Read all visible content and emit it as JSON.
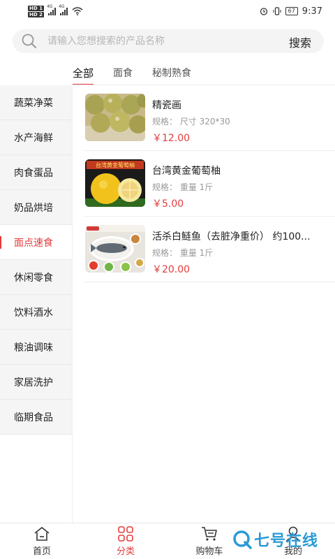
{
  "status_bar": {
    "network_1": "4G",
    "network_2": "4G",
    "hd_1": "HD 1",
    "hd_2": "HD 2",
    "battery": "67",
    "time": "9:37"
  },
  "search": {
    "placeholder": "请输入您想搜索的产品名称",
    "button_label": "搜索"
  },
  "tabs": [
    {
      "label": "全部",
      "active": true
    },
    {
      "label": "面食",
      "active": false
    },
    {
      "label": "秘制熟食",
      "active": false
    }
  ],
  "sidebar": {
    "items": [
      {
        "label": "蔬菜净菜"
      },
      {
        "label": "水产海鲜"
      },
      {
        "label": "肉食蛋品"
      },
      {
        "label": "奶品烘培"
      },
      {
        "label": "面点速食",
        "active": true
      },
      {
        "label": "休闲零食"
      },
      {
        "label": "饮料酒水"
      },
      {
        "label": "粮油调味"
      },
      {
        "label": "家居洗护"
      },
      {
        "label": "临期食品"
      }
    ]
  },
  "products": [
    {
      "name": "精瓷画",
      "spec": "规格：  尺寸 320*30",
      "price": "￥12.00",
      "image_icon": "fruit-photo"
    },
    {
      "name": "台湾黄金葡萄柚",
      "spec": "规格：  重量 1斤",
      "price": "￥5.00",
      "image_icon": "grapefruit-photo",
      "image_banner": "台湾黄金葡萄柚"
    },
    {
      "name": "活杀白鲢鱼（去脏净重价） 约100...",
      "spec": "规格：  重量 1斤",
      "price": "￥20.00",
      "image_icon": "fish-dish-photo"
    }
  ],
  "bottom_nav": [
    {
      "label": "首页",
      "icon": "home-icon",
      "active": false
    },
    {
      "label": "分类",
      "icon": "category-icon",
      "active": true
    },
    {
      "label": "购物车",
      "icon": "cart-icon",
      "active": false
    },
    {
      "label": "我的",
      "icon": "profile-icon",
      "active": false
    }
  ],
  "watermark": {
    "text": "七号在线"
  },
  "colors": {
    "accent": "#e23c3c",
    "sidebar_bg": "#f5f5f5",
    "watermark": "#2a9ad6"
  }
}
